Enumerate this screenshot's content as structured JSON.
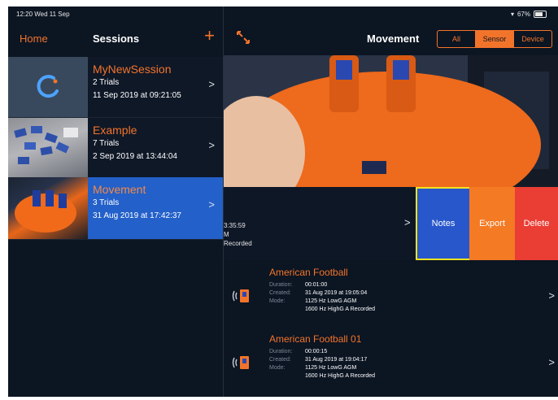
{
  "status_bar": {
    "time": "12:20  Wed 11 Sep",
    "battery": "67%"
  },
  "left_nav": {
    "home": "Home",
    "title": "Sessions",
    "add": "+"
  },
  "sessions": [
    {
      "name": "MyNewSession",
      "trials": "2 Trials",
      "date": "11 Sep 2019 at 09:21:05"
    },
    {
      "name": "Example",
      "trials": "7 Trials",
      "date": "2 Sep 2019 at 13:44:04"
    },
    {
      "name": "Movement",
      "trials": "3 Trials",
      "date": "31 Aug 2019 at 17:42:37"
    }
  ],
  "right_nav": {
    "title": "Movement",
    "segments": [
      "All",
      "Sensor",
      "Device"
    ],
    "selected": "Sensor"
  },
  "swiped_trial": {
    "line1": "3:35:59",
    "line2": "M",
    "line3": "Recorded"
  },
  "swipe_actions": {
    "notes": "Notes",
    "export": "Export",
    "delete": "Delete"
  },
  "recordings": [
    {
      "title": "American Football",
      "duration_label": "Duration:",
      "duration": "00:01:00",
      "created_label": "Created:",
      "created": "31 Aug 2019 at 19:05:04",
      "mode_label": "Mode:",
      "mode1": "1125 Hz LowG AGM",
      "mode2": "1600 Hz HighG A Recorded"
    },
    {
      "title": "American Football 01",
      "duration_label": "Duration:",
      "duration": "00:00:15",
      "created_label": "Created:",
      "created": "31 Aug 2019 at 19:04:17",
      "mode_label": "Mode:",
      "mode1": "1125 Hz LowG AGM",
      "mode2": "1600 Hz HighG A Recorded"
    }
  ],
  "colors": {
    "accent": "#f2742b",
    "selected": "#2360c9",
    "background": "#0c1522",
    "notes": "#2857cc",
    "delete": "#ea3d34",
    "highlight": "#f2e420"
  }
}
